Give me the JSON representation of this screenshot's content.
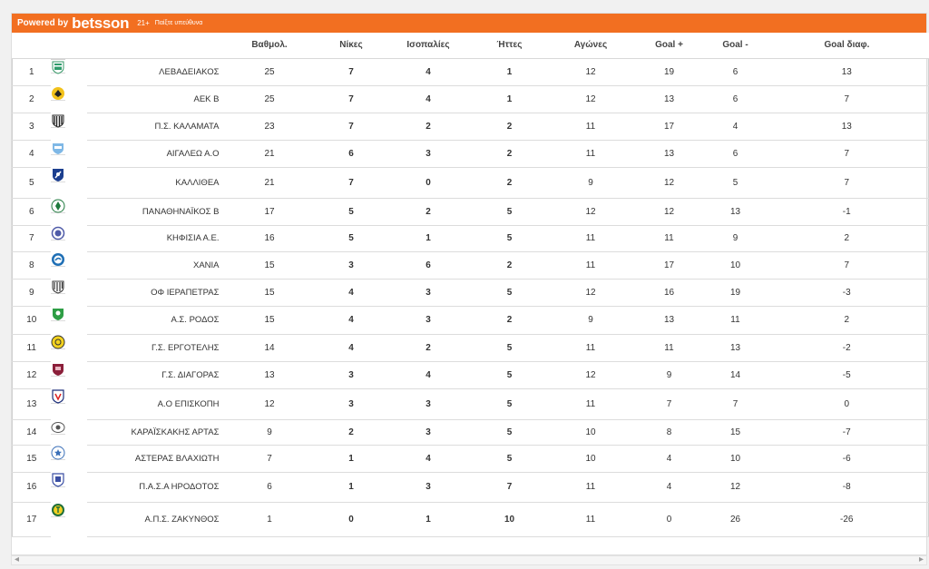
{
  "header": {
    "powered": "Powered by",
    "brand": "betsson",
    "age": "21+",
    "responsible": "Παίξτε υπεύθυνα"
  },
  "columns": [
    "Βαθμολ.",
    "Νίκες",
    "Ισοπαλίες",
    "Ήττες",
    "Αγώνες",
    "Goal +",
    "Goal -",
    "Goal διαφ."
  ],
  "rows": [
    {
      "pos": "1",
      "team": "ΛΕΒΑΔΕΙΑΚΟΣ",
      "pts": "25",
      "w": "7",
      "d": "4",
      "l": "1",
      "gp": "12",
      "gf": "19",
      "ga": "6",
      "gd": "13",
      "logo": "lev",
      "h": 30
    },
    {
      "pos": "2",
      "team": "ΑΕΚ Β",
      "pts": "25",
      "w": "7",
      "d": "4",
      "l": "1",
      "gp": "12",
      "gf": "13",
      "ga": "6",
      "gd": "7",
      "logo": "aek",
      "h": 30
    },
    {
      "pos": "3",
      "team": "Π.Σ. ΚΑΛΑΜΑΤΑ",
      "pts": "23",
      "w": "7",
      "d": "2",
      "l": "2",
      "gp": "11",
      "gf": "17",
      "ga": "4",
      "gd": "13",
      "logo": "kal",
      "h": 30
    },
    {
      "pos": "4",
      "team": "ΑΙΓΑΛΕΩ Α.Ο",
      "pts": "21",
      "w": "6",
      "d": "3",
      "l": "2",
      "gp": "11",
      "gf": "13",
      "ga": "6",
      "gd": "7",
      "logo": "aig",
      "h": 30
    },
    {
      "pos": "5",
      "team": "ΚΑΛΛΙΘΕΑ",
      "pts": "21",
      "w": "7",
      "d": "0",
      "l": "2",
      "gp": "9",
      "gf": "12",
      "ga": "5",
      "gd": "7",
      "logo": "kall",
      "h": 34
    },
    {
      "pos": "6",
      "team": "ΠΑΝΑΘΗΝΑΪΚΟΣ Β",
      "pts": "17",
      "w": "5",
      "d": "2",
      "l": "5",
      "gp": "12",
      "gf": "12",
      "ga": "13",
      "gd": "-1",
      "logo": "pao",
      "h": 30
    },
    {
      "pos": "7",
      "team": "ΚΗΦΙΣΙΑ Α.Ε.",
      "pts": "16",
      "w": "5",
      "d": "1",
      "l": "5",
      "gp": "11",
      "gf": "11",
      "ga": "9",
      "gd": "2",
      "logo": "kif",
      "h": 29
    },
    {
      "pos": "8",
      "team": "ΧΑΝΙΑ",
      "pts": "15",
      "w": "3",
      "d": "6",
      "l": "2",
      "gp": "11",
      "gf": "17",
      "ga": "10",
      "gd": "7",
      "logo": "xan",
      "h": 30
    },
    {
      "pos": "9",
      "team": "ΟΦ ΙΕΡΑΠΕΤΡΑΣ",
      "pts": "15",
      "w": "4",
      "d": "3",
      "l": "5",
      "gp": "12",
      "gf": "16",
      "ga": "19",
      "gd": "-3",
      "logo": "ofi",
      "h": 30
    },
    {
      "pos": "10",
      "team": "Α.Σ. ΡΟΔΟΣ",
      "pts": "15",
      "w": "4",
      "d": "3",
      "l": "2",
      "gp": "9",
      "gf": "13",
      "ga": "11",
      "gd": "2",
      "logo": "rod",
      "h": 31
    },
    {
      "pos": "11",
      "team": "Γ.Σ. ΕΡΓΟΤΕΛΗΣ",
      "pts": "14",
      "w": "4",
      "d": "2",
      "l": "5",
      "gp": "11",
      "gf": "11",
      "ga": "13",
      "gd": "-2",
      "logo": "erg",
      "h": 30
    },
    {
      "pos": "12",
      "team": "Γ.Σ. ΔΙΑΓΟΡΑΣ",
      "pts": "13",
      "w": "3",
      "d": "4",
      "l": "5",
      "gp": "12",
      "gf": "9",
      "ga": "14",
      "gd": "-5",
      "logo": "dia",
      "h": 30
    },
    {
      "pos": "13",
      "team": "Α.Ο ΕΠΙΣΚΟΠΗ",
      "pts": "12",
      "w": "3",
      "d": "3",
      "l": "5",
      "gp": "11",
      "gf": "7",
      "ga": "7",
      "gd": "0",
      "logo": "epi",
      "h": 34
    },
    {
      "pos": "14",
      "team": "ΚΑΡΑΪΣΚΑΚΗΣ ΑΡΤΑΣ",
      "pts": "9",
      "w": "2",
      "d": "3",
      "l": "5",
      "gp": "10",
      "gf": "8",
      "ga": "15",
      "gd": "-7",
      "logo": "kar",
      "h": 28
    },
    {
      "pos": "15",
      "team": "ΑΣΤΕΡΑΣ ΒΛΑΧΙΩΤΗ",
      "pts": "7",
      "w": "1",
      "d": "4",
      "l": "5",
      "gp": "10",
      "gf": "4",
      "ga": "10",
      "gd": "-6",
      "logo": "ast",
      "h": 30
    },
    {
      "pos": "16",
      "team": "Π.Α.Σ.Α ΗΡΟΔΟΤΟΣ",
      "pts": "6",
      "w": "1",
      "d": "3",
      "l": "7",
      "gp": "11",
      "gf": "4",
      "ga": "12",
      "gd": "-8",
      "logo": "iro",
      "h": 33
    },
    {
      "pos": "17",
      "team": "Α.Π.Σ. ΖΑΚΥΝΘΟΣ",
      "pts": "1",
      "w": "0",
      "d": "1",
      "l": "10",
      "gp": "11",
      "gf": "0",
      "ga": "26",
      "gd": "-26",
      "logo": "zak",
      "h": 38
    }
  ],
  "scrollbar": {
    "left": "◂",
    "right": "▸"
  }
}
